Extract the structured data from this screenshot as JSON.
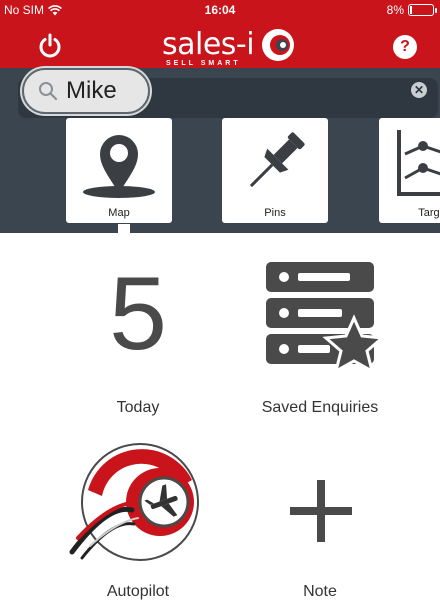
{
  "status_bar": {
    "carrier": "No SIM",
    "time": "16:04",
    "battery": "8%",
    "battery_level": 0.08
  },
  "nav": {
    "logo_text": "sales-i",
    "logo_tagline": "SELL SMART",
    "help_label": "?"
  },
  "search": {
    "value": "Mike",
    "clear_label": "✕"
  },
  "tiles": [
    {
      "label": "Map",
      "icon": "map-pin-icon"
    },
    {
      "label": "Pins",
      "icon": "pushpin-icon"
    },
    {
      "label": "Targe",
      "icon": "targets-chart-icon"
    }
  ],
  "grid": [
    {
      "value": "5",
      "label": "Today"
    },
    {
      "label": "Saved Enquiries",
      "icon": "saved-enquiries-icon"
    },
    {
      "label": "Autopilot",
      "icon": "autopilot-icon"
    },
    {
      "label": "Note",
      "icon": "plus-icon"
    }
  ],
  "colors": {
    "brand_red": "#c8141a",
    "dark_band": "#3b4550",
    "icon_gray": "#4a4a4a"
  }
}
